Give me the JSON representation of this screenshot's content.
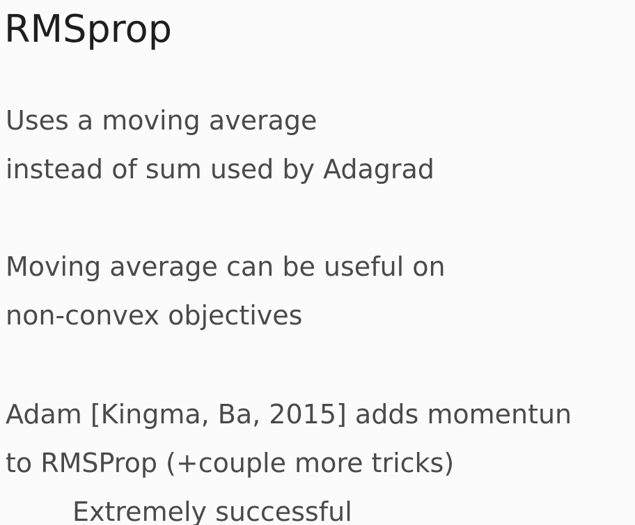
{
  "slide": {
    "title": "RMSprop",
    "lines": [
      "Uses a moving average",
      "instead of sum used by Adagrad",
      "Moving average can be useful on",
      "non-convex objectives",
      "Adam [Kingma, Ba, 2015] adds momentun",
      "to RMSProp (+couple more tricks)",
      "Extremely successful"
    ]
  }
}
